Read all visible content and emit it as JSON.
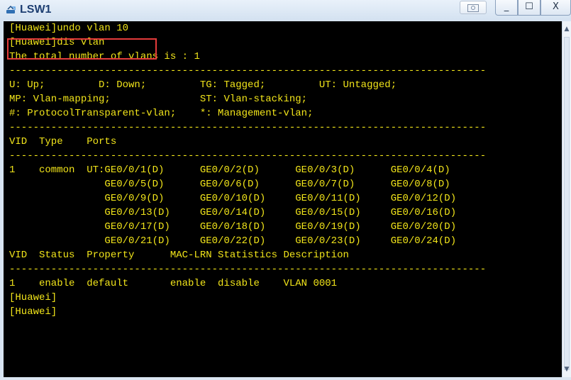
{
  "window": {
    "title": "LSW1",
    "icon": "switch-icon",
    "buttons": {
      "screenshot_icon": "screenshot-icon",
      "minimize": "_",
      "maximize": "☐",
      "close": "X"
    }
  },
  "terminal": {
    "lines": [
      "[Huawei]undo vlan 10",
      "[Huawei]dis vlan",
      "The total number of vlans is : 1",
      "--------------------------------------------------------------------------------",
      "U: Up;         D: Down;         TG: Tagged;         UT: Untagged;",
      "MP: Vlan-mapping;               ST: Vlan-stacking;",
      "#: ProtocolTransparent-vlan;    *: Management-vlan;",
      "--------------------------------------------------------------------------------",
      "",
      "VID  Type    Ports",
      "--------------------------------------------------------------------------------",
      "1    common  UT:GE0/0/1(D)      GE0/0/2(D)      GE0/0/3(D)      GE0/0/4(D)",
      "                GE0/0/5(D)      GE0/0/6(D)      GE0/0/7(D)      GE0/0/8(D)",
      "                GE0/0/9(D)      GE0/0/10(D)     GE0/0/11(D)     GE0/0/12(D)",
      "                GE0/0/13(D)     GE0/0/14(D)     GE0/0/15(D)     GE0/0/16(D)",
      "                GE0/0/17(D)     GE0/0/18(D)     GE0/0/19(D)     GE0/0/20(D)",
      "                GE0/0/21(D)     GE0/0/22(D)     GE0/0/23(D)     GE0/0/24(D)",
      "",
      "",
      "VID  Status  Property      MAC-LRN Statistics Description",
      "--------------------------------------------------------------------------------",
      "1    enable  default       enable  disable    VLAN 0001",
      "[Huawei]",
      "[Huawei]"
    ],
    "text_color": "#f2e51a",
    "background": "#000000"
  },
  "annotation": {
    "box_color": "#e53b3b"
  }
}
